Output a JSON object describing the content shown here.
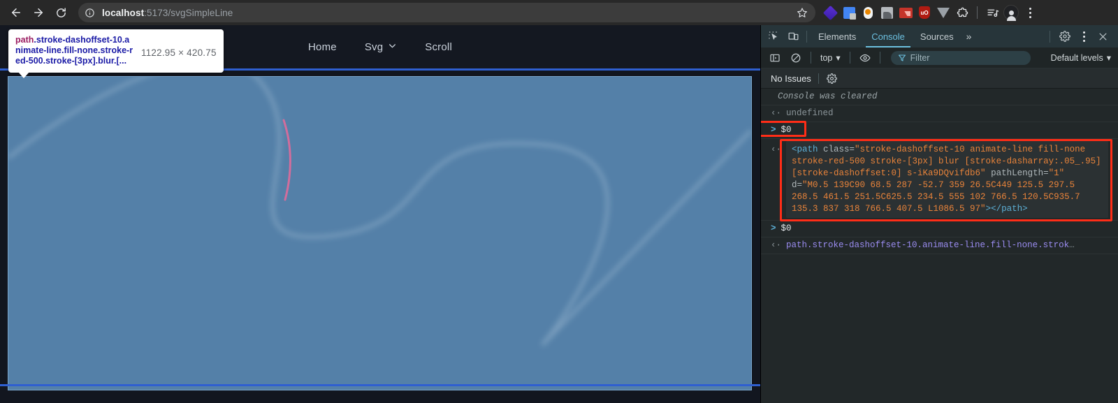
{
  "browser": {
    "back_title": "Back",
    "forward_title": "Forward",
    "reload_title": "Reload",
    "url_host": "localhost",
    "url_rest": ":5173/svgSimpleLine",
    "bookmark_title": "Bookmark this tab",
    "extensions": [
      {
        "name": "extension-diamond-icon",
        "label": "Diamond extension"
      },
      {
        "name": "extension-gdocs-icon",
        "label": "Google Docs extension"
      },
      {
        "name": "extension-pill-icon",
        "label": "Pill extension"
      },
      {
        "name": "extension-gray-icon",
        "label": "Gray extension"
      },
      {
        "name": "extension-red-chart-icon",
        "label": "Red chart extension"
      },
      {
        "name": "extension-ublock-icon",
        "label": "uBlock Origin",
        "text": "uO"
      },
      {
        "name": "extension-v-icon",
        "label": "V extension"
      },
      {
        "name": "extensions-puzzle-icon",
        "label": "Extensions"
      }
    ],
    "media_title": "Media controls",
    "profile_title": "Profile",
    "menu_title": "Customize and control Chrome"
  },
  "page": {
    "nav": [
      {
        "label": "Home",
        "chevron": false
      },
      {
        "label": "Svg",
        "chevron": true
      },
      {
        "label": "Scroll",
        "chevron": false
      }
    ],
    "highlight_color": "#5480a8",
    "rule_color": "#2f5fd0",
    "stroke_color": "#e86a9a"
  },
  "tooltip": {
    "tag": "path",
    "selector_rest": ".stroke-dashoffset-10.animate-line.fill-none.stroke-red-500.stroke-[3px].blur.[...",
    "dimensions": "1122.95 × 420.75"
  },
  "devtools": {
    "inspect_icon_title": "Inspect element",
    "device_icon_title": "Toggle device toolbar",
    "tabs": [
      {
        "label": "Elements",
        "active": false
      },
      {
        "label": "Console",
        "active": true
      },
      {
        "label": "Sources",
        "active": false
      }
    ],
    "more_tabs": "»",
    "settings_title": "Settings",
    "kebab_title": "More options",
    "close_title": "Close DevTools",
    "toolbar": {
      "sidebar_title": "Show console sidebar",
      "clear_title": "Clear console",
      "context": "top",
      "context_caret": "▾",
      "eye_title": "Create live expression",
      "filter_placeholder": "Filter",
      "levels": "Default levels",
      "levels_caret": "▾"
    },
    "issues": {
      "text": "No Issues",
      "settings_title": "Issues settings"
    },
    "console": {
      "cleared_message": "Console was cleared",
      "undefined_value": "undefined",
      "command_1": "$0",
      "command_2": "$0",
      "result_xml": {
        "open_tag": "<path",
        "attr_class_name": " class=",
        "attr_class_value": "\"stroke-dashoffset-10 animate-line fill-none stroke-red-500 stroke-[3px] blur [stroke-dasharray:.05_.95] [stroke-dashoffset:0] s-iKa9DQvifdb6\"",
        "attr_pathlength_name": " pathLength=",
        "attr_pathlength_value": "\"1\"",
        "attr_d_name": " d=",
        "attr_d_value": "\"M0.5 139C90 68.5 287 -52.7 359 26.5C449 125.5 297.5 268.5 461.5 251.5C625.5 234.5 555 102 766.5 120.5C935.7 135.3 837 318 766.5 407.5 L1086.5 97\"",
        "close_bracket": ">",
        "close_tag": "</path>"
      },
      "result_selector": "path.stroke-dashoffset-10.animate-line.fill-none.strok",
      "result_selector_ellipsis": "…",
      "prompt_in": ">",
      "prompt_out": "‹·",
      "highlight_color": "#ff2d17"
    }
  }
}
